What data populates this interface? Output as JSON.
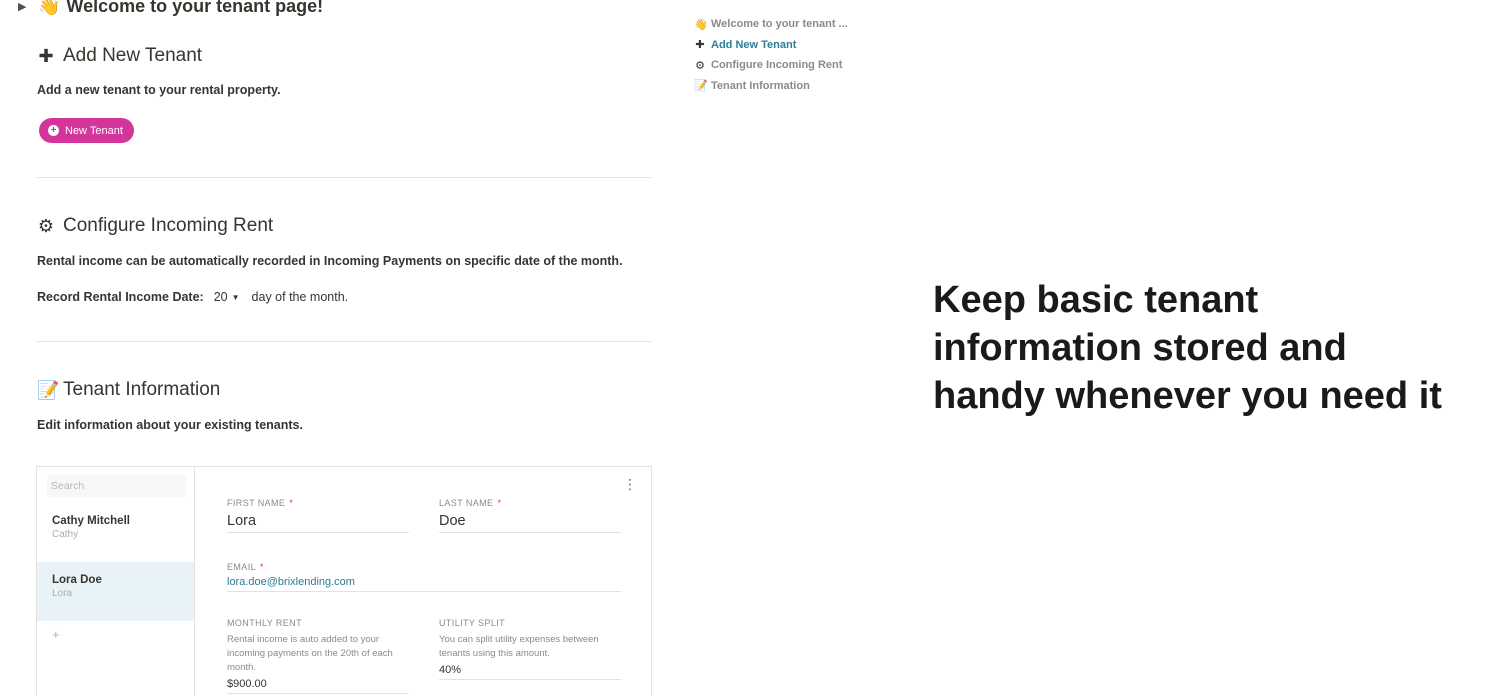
{
  "page": {
    "toggle_title": "Welcome to your tenant page!",
    "toggle_emoji": "👋"
  },
  "add_tenant": {
    "icon": "plus-icon",
    "title": "Add New Tenant",
    "description": "Add a new tenant to your rental property.",
    "button_label": "New Tenant",
    "button_color": "#d4359b"
  },
  "configure_rent": {
    "icon": "gear-icon",
    "title": "Configure Incoming Rent",
    "description": "Rental income can be automatically recorded in Incoming Payments on specific date of the month.",
    "date_label": "Record Rental Income Date:",
    "date_value": "20",
    "date_suffix": "day of the month."
  },
  "tenant_info": {
    "icon": "memo-icon",
    "title": "Tenant Information",
    "description": "Edit information about your existing tenants.",
    "search_placeholder": "Search",
    "tenants": [
      {
        "name": "Cathy Mitchell",
        "nickname": "Cathy",
        "selected": false
      },
      {
        "name": "Lora Doe",
        "nickname": "Lora",
        "selected": true
      }
    ],
    "form": {
      "first_name_label": "FIRST NAME",
      "first_name": "Lora",
      "last_name_label": "LAST NAME",
      "last_name": "Doe",
      "email_label": "EMAIL",
      "email": "lora.doe@brixlending.com",
      "monthly_rent_label": "MONTHLY RENT",
      "monthly_rent_help": "Rental income is auto added to your incoming payments on the 20th of each month.",
      "monthly_rent": "$900.00",
      "utility_split_label": "UTILITY SPLIT",
      "utility_split_help": "You can split utility expenses between tenants using this amount.",
      "utility_split": "40%",
      "required_marker": "*"
    }
  },
  "toc": {
    "items": [
      {
        "icon": "👋",
        "label": "Welcome to your tenant ...",
        "active": false
      },
      {
        "icon": "✚",
        "label": "Add New Tenant",
        "active": true
      },
      {
        "icon": "⚙",
        "label": "Configure Incoming Rent",
        "active": false
      },
      {
        "icon": "📝",
        "label": "Tenant Information",
        "active": false
      }
    ],
    "active_color": "#2a7f95"
  },
  "headline": {
    "line1": "Keep basic tenant",
    "line2": "information stored and",
    "line3": "handy whenever you need it"
  }
}
